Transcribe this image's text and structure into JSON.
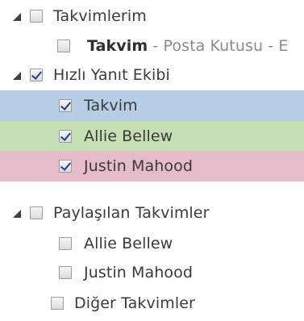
{
  "tree": {
    "my_calendars": {
      "label": "Takvimlerim",
      "checked": false
    },
    "my_calendar_item": {
      "name": "Takvim",
      "sep": " - ",
      "detail": "Posta Kutusu - E",
      "checked": false
    },
    "team": {
      "label": "Hızlı Yanıt Ekibi",
      "checked": true
    },
    "team_members": [
      {
        "label": "Takvim",
        "checked": true,
        "color": "#b6cde5"
      },
      {
        "label": "Allie Bellew",
        "checked": true,
        "color": "#c5dfb4"
      },
      {
        "label": "Justin Mahood",
        "checked": true,
        "color": "#e6bccb"
      }
    ],
    "shared": {
      "label": "Paylaşılan Takvimler",
      "checked": false
    },
    "shared_members": [
      {
        "label": "Allie Bellew",
        "checked": false
      },
      {
        "label": "Justin Mahood",
        "checked": false
      }
    ],
    "other": {
      "label": "Diğer Takvimler",
      "checked": false
    }
  }
}
